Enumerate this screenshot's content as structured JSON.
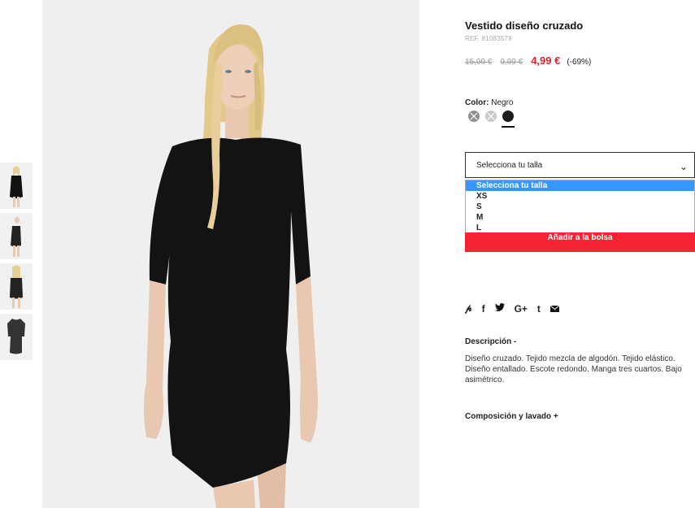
{
  "product": {
    "title": "Vestido diseño cruzado",
    "ref": "REF. 81083578",
    "price_original": "15,99 €",
    "price_previous": "9,99 €",
    "price_current": "4,99 €",
    "discount": "(-69%)"
  },
  "color": {
    "label": "Color:",
    "value": "Negro",
    "swatches": [
      {
        "name": "gris oscuro",
        "color": "#8f8f8f",
        "available": false
      },
      {
        "name": "gris claro",
        "color": "#c9c9c9",
        "available": false
      },
      {
        "name": "negro",
        "color": "#1c1c1c",
        "available": true,
        "selected": true
      }
    ]
  },
  "size": {
    "placeholder": "Selecciona tu talla",
    "options": [
      "Selecciona tu talla",
      "XS",
      "S",
      "M",
      "L"
    ]
  },
  "cart": {
    "add_label": "Añadir a la bolsa"
  },
  "social": [
    "P",
    "f",
    "t",
    "G+",
    "t",
    "✉"
  ],
  "description": {
    "heading": "Descripción  -",
    "text": "Diseño cruzado. Tejido mezcla de algodón. Tejido elástico. Diseño entallado. Escote redondo. Manga tres cuartos. Bajo asimétrico."
  },
  "composition": {
    "heading": "Composición y lavado  +"
  }
}
